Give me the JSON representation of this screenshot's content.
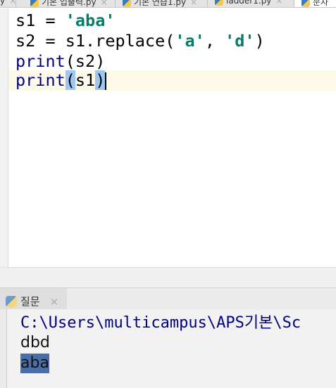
{
  "tabs": [
    {
      "label": "y"
    },
    {
      "label": "기본 입출력.py"
    },
    {
      "label": "기본 연습1.py"
    },
    {
      "label": "ladder1.py"
    },
    {
      "label": "문자"
    }
  ],
  "editor": {
    "lines": [
      {
        "a": "s1 = ",
        "s": "'aba'"
      },
      {
        "a": "s2 = s1.replace(",
        "s1": "'a'",
        "b": ", ",
        "s2": "'d'",
        "c": ")"
      },
      {
        "f": "print",
        "a": "(s2)"
      },
      {
        "f": "print",
        "o": "(",
        "a": "s1",
        "c": ")"
      }
    ]
  },
  "run": {
    "tab_label": "질문",
    "close": "×"
  },
  "console": {
    "lines": [
      "C:\\Users\\multicampus\\APS기본\\Sc",
      "dbd",
      "aba"
    ]
  }
}
